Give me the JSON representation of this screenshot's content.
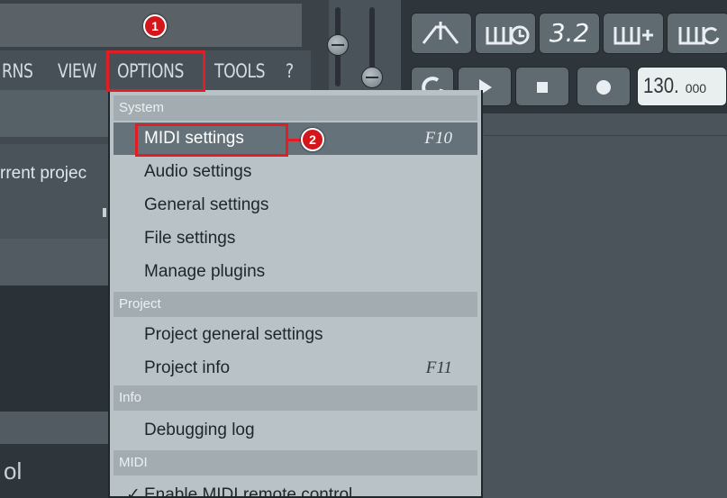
{
  "menubar": {
    "items": [
      "RNS",
      "VIEW",
      "OPTIONS",
      "TOOLS",
      "?"
    ]
  },
  "browser": {
    "current_project_label": "rrent projec",
    "bottom_label": "ol"
  },
  "transport": {
    "buttons": [
      "metronome",
      "wait-for-input",
      "3.2",
      "step-edit",
      "loop-record"
    ],
    "display_32": "3.2",
    "tempo_main": "130.",
    "tempo_decimal": "000"
  },
  "options_menu": {
    "sections": [
      {
        "title": "System",
        "items": [
          {
            "label": "MIDI settings",
            "shortcut": "F10",
            "highlighted": true
          },
          {
            "label": "Audio settings",
            "shortcut": ""
          },
          {
            "label": "General settings",
            "shortcut": ""
          },
          {
            "label": "File settings",
            "shortcut": ""
          },
          {
            "label": "Manage plugins",
            "shortcut": ""
          }
        ]
      },
      {
        "title": "Project",
        "items": [
          {
            "label": "Project general settings",
            "shortcut": ""
          },
          {
            "label": "Project info",
            "shortcut": "F11"
          }
        ]
      },
      {
        "title": "Info",
        "items": [
          {
            "label": "Debugging log",
            "shortcut": ""
          }
        ]
      },
      {
        "title": "MIDI",
        "items": [
          {
            "label": "Enable MIDI remote control",
            "shortcut": "",
            "checked": true
          }
        ]
      }
    ]
  },
  "annotations": {
    "step1": "1",
    "step2": "2"
  },
  "colors": {
    "callout_red": "#e21d26",
    "menu_bg": "#b9c2c6",
    "menu_section_bg": "#a3acb0",
    "highlight_bg": "#65727a"
  }
}
